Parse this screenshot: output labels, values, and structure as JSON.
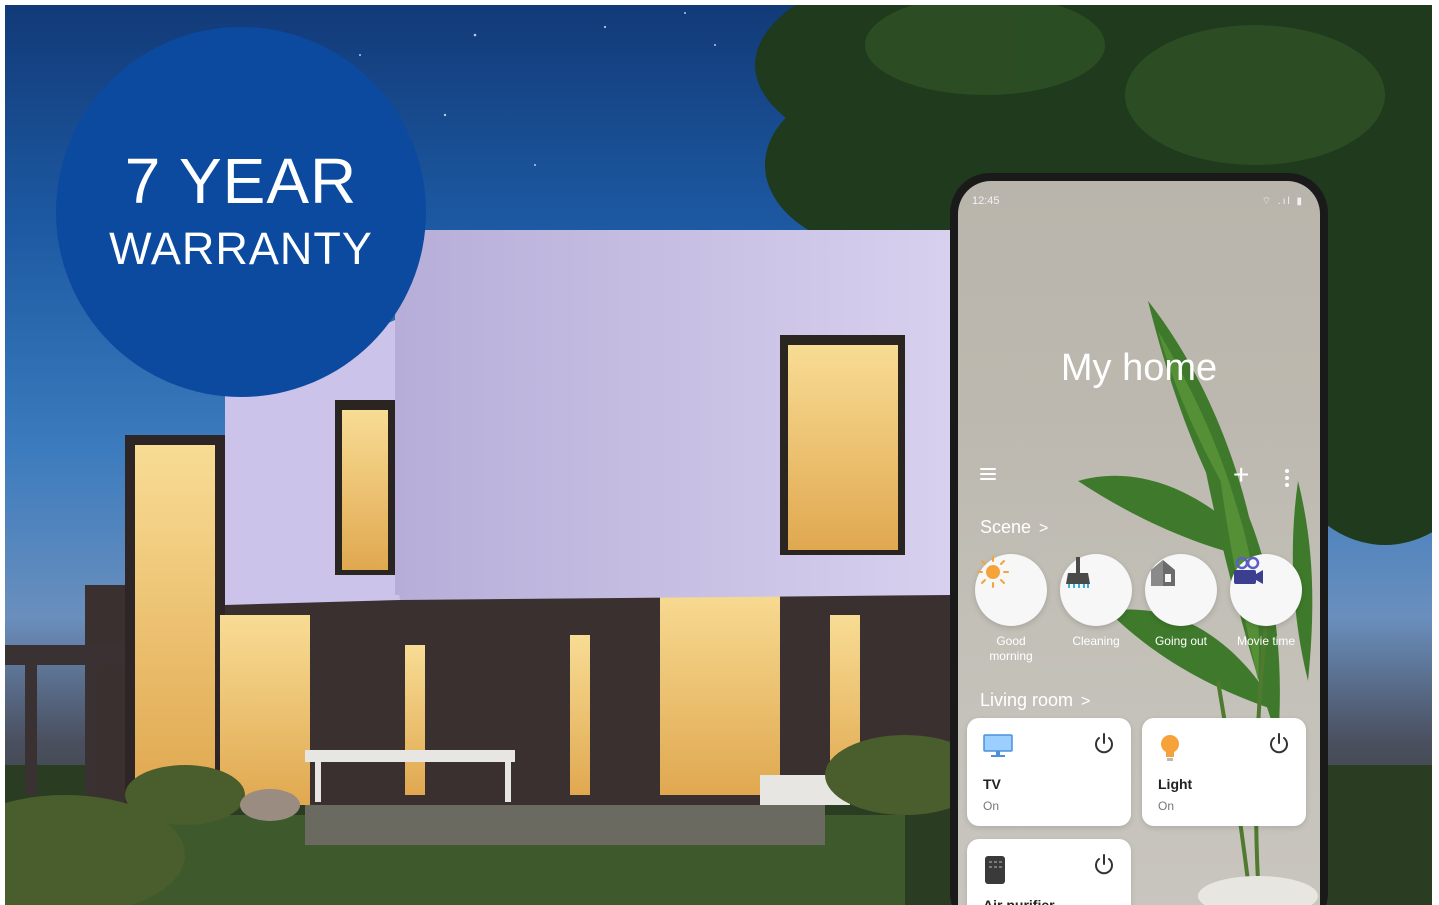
{
  "warranty": {
    "line1": "7 YEAR",
    "line2": "WARRANTY"
  },
  "phone": {
    "status_time": "12:45",
    "status_icons": "⌔ .ıl ▮",
    "app_title": "My home",
    "scene_section": {
      "title": "Scene",
      "items": [
        {
          "label": "Good morning",
          "icon": "sun-icon"
        },
        {
          "label": "Cleaning",
          "icon": "broom-icon"
        },
        {
          "label": "Going out",
          "icon": "house-icon"
        },
        {
          "label": "Movie time",
          "icon": "video-camera-icon"
        }
      ]
    },
    "living_room": {
      "title": "Living room",
      "devices": [
        {
          "name": "TV",
          "state": "On",
          "icon": "tv-icon"
        },
        {
          "name": "Light",
          "state": "On",
          "icon": "light-bulb-icon"
        },
        {
          "name": "Air purifier",
          "state": "",
          "icon": "air-purifier-icon"
        }
      ]
    }
  },
  "colors": {
    "badge_blue": "#0c4aa0",
    "sky_top": "#123a78",
    "window_glow": "#f2c46a",
    "house_wall": "#c9c0e6"
  }
}
